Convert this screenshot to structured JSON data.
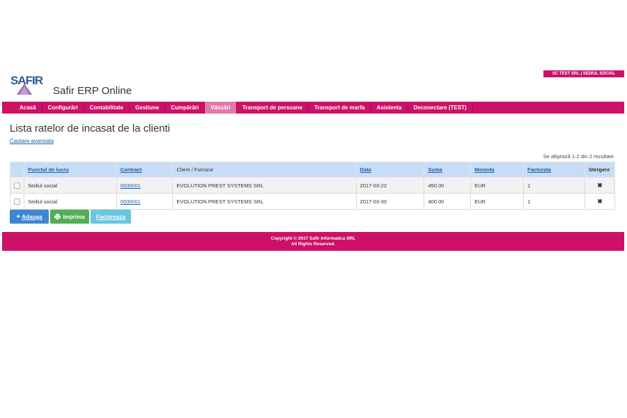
{
  "header": {
    "company_badge": "SC TEST SRL | SEDIUL SOCIAL",
    "logo_text": "SAFIR",
    "app_title": "Safir ERP Online"
  },
  "nav": {
    "items": [
      {
        "label": "Acasă"
      },
      {
        "label": "Configurări"
      },
      {
        "label": "Contabilitate"
      },
      {
        "label": "Gestiune"
      },
      {
        "label": "Cumpărări"
      },
      {
        "label": "Vânzări",
        "active": true
      },
      {
        "label": "Transport de persoane"
      },
      {
        "label": "Transport de marfa"
      },
      {
        "label": "Asistenta"
      },
      {
        "label": "Deconectare (TEST)"
      }
    ]
  },
  "main": {
    "title": "Lista ratelor de incasat de la clienti",
    "advanced_search": "Cautare avansata",
    "results_text": "Se afişează 1-2 din 2 rezultate."
  },
  "table": {
    "headers": {
      "punct": "Punctul de lucru",
      "contract": "Contract",
      "client": "Client / Furnizor",
      "data": "Data",
      "suma": "Suma",
      "moneda": "Moneda",
      "facturata": "Facturata",
      "stergere": "Stergere"
    },
    "rows": [
      {
        "punct": "Sediul social",
        "contract": "0000001",
        "client": "EVOLUTION PREST SYSTEMS SRL",
        "data": "2017-03-22",
        "suma": "450.00",
        "moneda": "EUR",
        "facturata": "1",
        "delete": "✖"
      },
      {
        "punct": "Sediul social",
        "contract": "0000001",
        "client": "EVOLUTION PREST SYSTEMS SRL",
        "data": "2017-03-30",
        "suma": "400.00",
        "moneda": "EUR",
        "facturata": "1",
        "delete": "✖"
      }
    ]
  },
  "buttons": {
    "add": "Adauga",
    "print": "Imprima",
    "invoice": "Factureaza"
  },
  "footer": {
    "line1": "Copyright © 2017 Safir Informatica SRL",
    "line2": "All Rights Reserved."
  },
  "colors": {
    "brand": "#cc1166",
    "nav_active": "#e07aa9",
    "table_header": "#c9dcf6",
    "link": "#1a5fa8",
    "add_button": "#3f86d1",
    "print_button": "#53ae55",
    "invoice_button": "#67c6e0"
  },
  "icons": {
    "add": "plus-icon",
    "print": "printer-icon",
    "delete": "delete-x-icon"
  }
}
